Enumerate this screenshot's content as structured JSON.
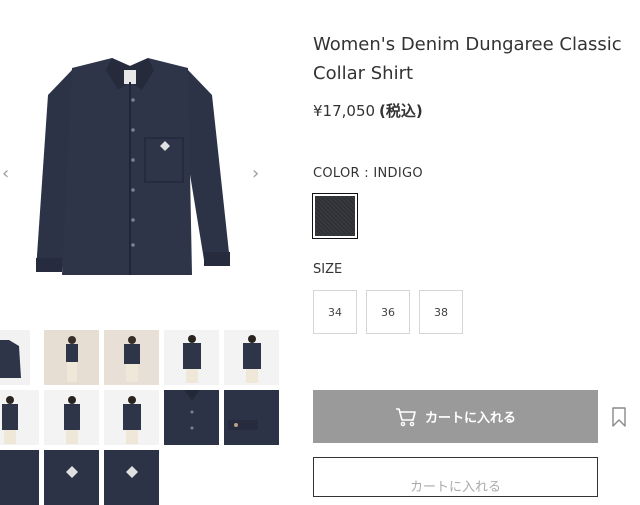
{
  "product": {
    "title": "Women's Denim Dungaree Classic Collar Shirt",
    "price": "¥17,050",
    "tax_note": "(税込)"
  },
  "gallery": {
    "prev_arrow": "‹",
    "next_arrow": "›",
    "thumbnail_count": 13
  },
  "color": {
    "label": "COLOR : INDIGO",
    "selected": "INDIGO",
    "swatch_color": "#2f3136"
  },
  "size": {
    "label": "SIZE",
    "options": [
      "34",
      "36",
      "38"
    ]
  },
  "actions": {
    "cart_label": "カートに入れる",
    "cart_icon": "cart-icon",
    "bookmark_icon": "bookmark-icon",
    "second_button_label": "カートに入れる"
  },
  "colors": {
    "cart_button_bg": "#9a9a9a",
    "denim": "#2b3245"
  }
}
